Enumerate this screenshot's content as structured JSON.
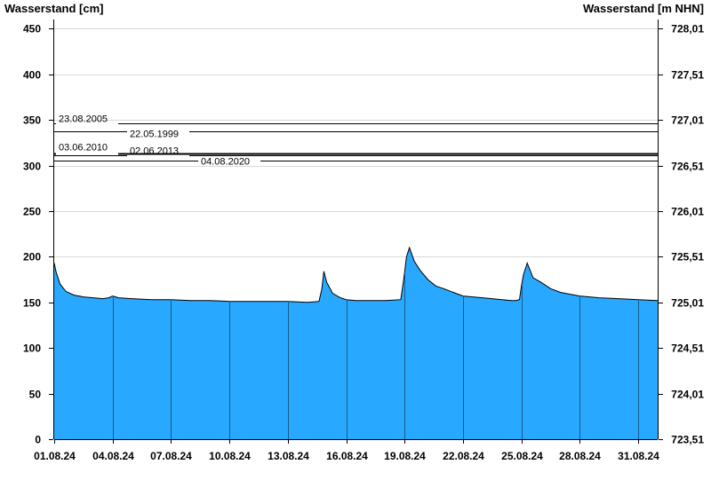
{
  "colors": {
    "area_fill": "#29a8ff",
    "area_line": "#000000",
    "grid": "#d9d9d9",
    "axis": "#000000",
    "background": "#ffffff"
  },
  "chart_data": {
    "type": "area",
    "ylabel_left": "Wasserstand [cm]",
    "ylabel_right": "Wasserstand [m NHN]",
    "ylim_left": [
      0,
      460
    ],
    "yticks_left": [
      0,
      50,
      100,
      150,
      200,
      250,
      300,
      350,
      400,
      450
    ],
    "yticks_right": [
      "723,51",
      "724,01",
      "724,51",
      "725,01",
      "725,51",
      "726,01",
      "726,51",
      "727,01",
      "727,51",
      "728,01"
    ],
    "xlim_days": [
      0,
      31
    ],
    "xticks": [
      {
        "label": "01.08.24",
        "day": 0
      },
      {
        "label": "04.08.24",
        "day": 3
      },
      {
        "label": "07.08.24",
        "day": 6
      },
      {
        "label": "10.08.24",
        "day": 9
      },
      {
        "label": "13.08.24",
        "day": 12
      },
      {
        "label": "16.08.24",
        "day": 15
      },
      {
        "label": "19.08.24",
        "day": 18
      },
      {
        "label": "22.08.24",
        "day": 21
      },
      {
        "label": "25.08.24",
        "day": 24
      },
      {
        "label": "28.08.24",
        "day": 27
      },
      {
        "label": "31.08.24",
        "day": 30
      }
    ],
    "grid": true,
    "flood_marks": [
      {
        "label": "23.08.2005",
        "value": 346
      },
      {
        "label": "22.05.1999",
        "value": 337
      },
      {
        "label": "03.06.2010",
        "value": 313
      },
      {
        "label": "02.06.2013",
        "value": 311
      },
      {
        "label": "04.08.2020",
        "value": 305
      }
    ],
    "series": [
      {
        "x": [
          0.0,
          0.1,
          0.3,
          0.6,
          1.0,
          1.5,
          2.0,
          2.5,
          2.8,
          3.0,
          3.3,
          4.0,
          5.0,
          6.0,
          7.0,
          8.0,
          9.0,
          10.0,
          11.0,
          12.0,
          13.0,
          13.6,
          13.75,
          13.85,
          14.0,
          14.3,
          14.7,
          15.0,
          15.5,
          16.0,
          17.0,
          17.8,
          17.95,
          18.1,
          18.25,
          18.5,
          18.8,
          19.2,
          19.6,
          20.0,
          20.5,
          21.0,
          22.0,
          23.0,
          23.5,
          23.7,
          23.9,
          24.0,
          24.1,
          24.3,
          24.6,
          25.0,
          25.5,
          26.0,
          27.0,
          28.0,
          29.0,
          30.0,
          31.0
        ],
        "y": [
          193,
          183,
          170,
          162,
          158,
          156,
          155,
          154,
          155,
          157,
          155,
          154,
          153,
          153,
          152,
          152,
          151,
          151,
          151,
          151,
          150,
          151,
          165,
          184,
          172,
          160,
          155,
          153,
          152,
          152,
          152,
          153,
          175,
          200,
          210,
          195,
          185,
          175,
          168,
          165,
          161,
          157,
          155,
          153,
          152,
          152,
          153,
          168,
          180,
          193,
          177,
          172,
          165,
          161,
          157,
          155,
          154,
          153,
          152
        ]
      }
    ]
  }
}
